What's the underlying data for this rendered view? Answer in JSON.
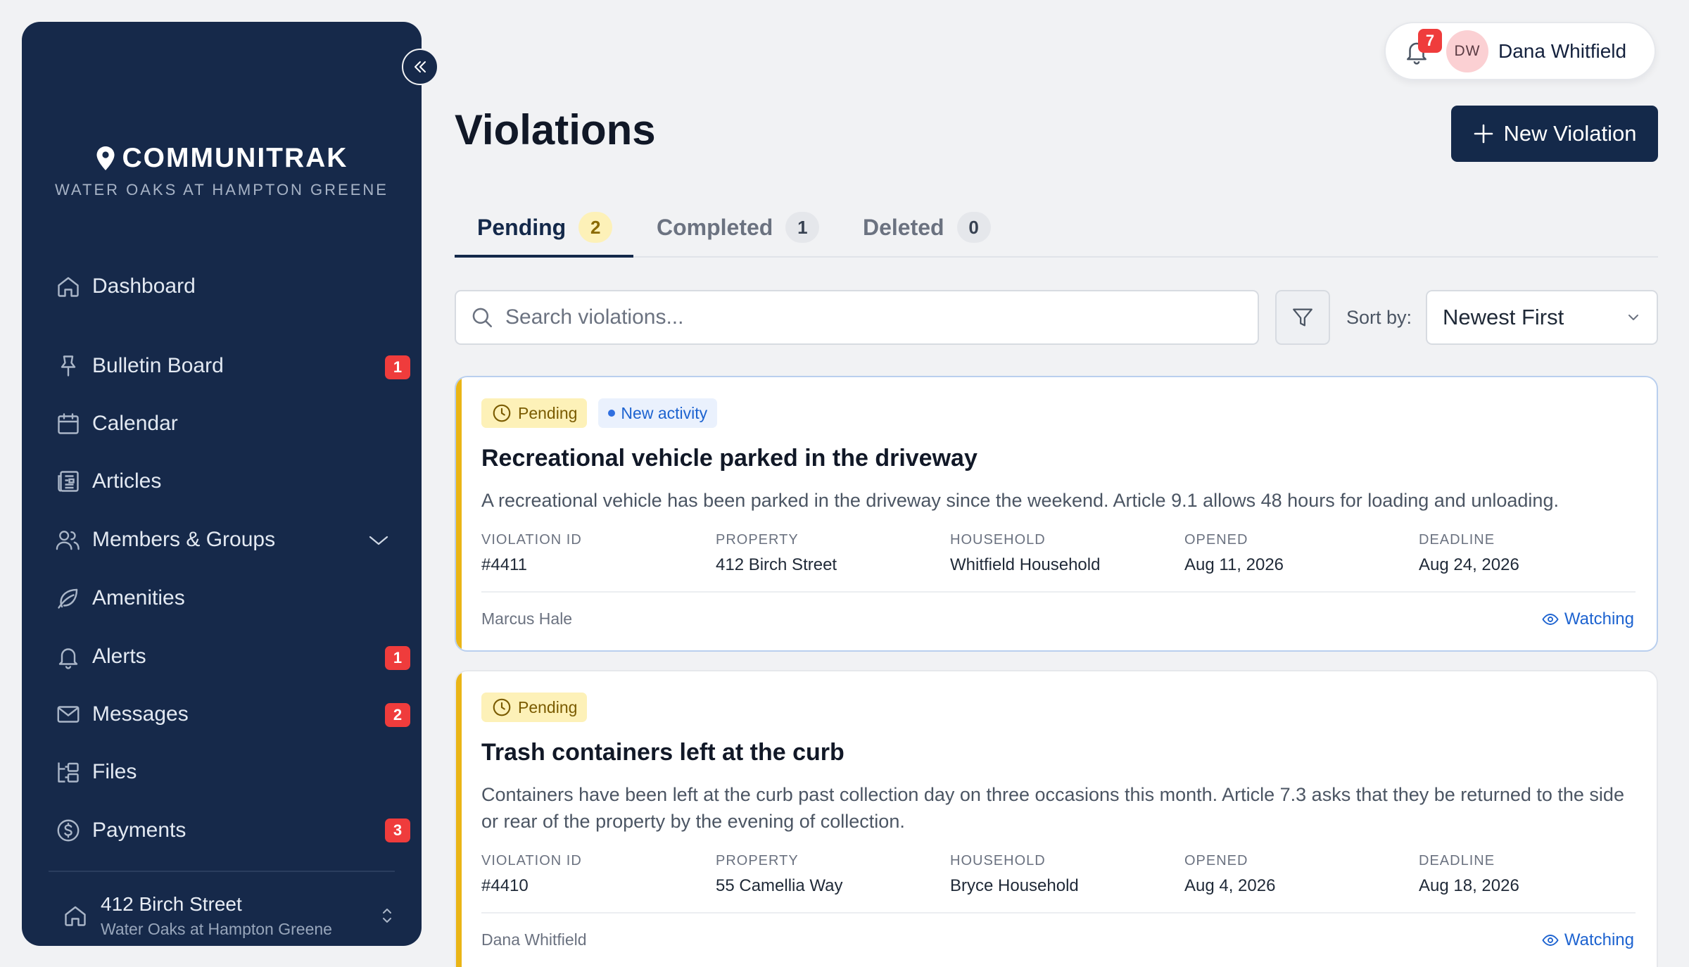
{
  "brand": {
    "name": "COMMUNITRAK",
    "community": "WATER OAKS AT HAMPTON GREENE"
  },
  "sidebar": {
    "items": [
      {
        "label": "Dashboard",
        "icon": "home-icon",
        "badge": ""
      },
      {
        "label": "Bulletin Board",
        "icon": "pin-icon",
        "badge": "1"
      },
      {
        "label": "Calendar",
        "icon": "calendar-icon",
        "badge": ""
      },
      {
        "label": "Articles",
        "icon": "newspaper-icon",
        "badge": ""
      },
      {
        "label": "Members & Groups",
        "icon": "users-icon",
        "badge": ""
      },
      {
        "label": "Amenities",
        "icon": "leaf-icon",
        "badge": ""
      },
      {
        "label": "Alerts",
        "icon": "bell-icon",
        "badge": "1"
      },
      {
        "label": "Messages",
        "icon": "mail-icon",
        "badge": "2"
      },
      {
        "label": "Files",
        "icon": "folder-tree-icon",
        "badge": ""
      },
      {
        "label": "Payments",
        "icon": "dollar-circle-icon",
        "badge": "3"
      }
    ],
    "property": {
      "address": "412 Birch Street",
      "community": "Water Oaks at Hampton Greene"
    }
  },
  "user": {
    "notifications": "7",
    "initials": "DW",
    "name": "Dana Whitfield"
  },
  "header": {
    "title": "Violations",
    "new_button": "New Violation"
  },
  "tabs": [
    {
      "label": "Pending",
      "count": "2"
    },
    {
      "label": "Completed",
      "count": "1"
    },
    {
      "label": "Deleted",
      "count": "0"
    }
  ],
  "toolbar": {
    "search_placeholder": "Search violations...",
    "sort_label": "Sort by:",
    "sort_value": "Newest First"
  },
  "meta_labels": {
    "id": "VIOLATION ID",
    "property": "PROPERTY",
    "household": "HOUSEHOLD",
    "opened": "OPENED",
    "deadline": "DEADLINE"
  },
  "violations": [
    {
      "status": "Pending",
      "activity": "New activity",
      "title": "Recreational vehicle parked in the driveway",
      "description": "A recreational vehicle has been parked in the driveway since the weekend. Article 9.1 allows 48 hours for loading and unloading.",
      "id": "#4411",
      "property": "412 Birch Street",
      "household": "Whitfield Household",
      "opened": "Aug 11, 2026",
      "deadline": "Aug 24, 2026",
      "author": "Marcus Hale",
      "watching": "Watching"
    },
    {
      "status": "Pending",
      "title": "Trash containers left at the curb",
      "description": "Containers have been left at the curb past collection day on three occasions this month. Article 7.3 asks that they be returned to the side or rear of the property by the evening of collection.",
      "id": "#4410",
      "property": "55 Camellia Way",
      "household": "Bryce Household",
      "opened": "Aug 4, 2026",
      "deadline": "Aug 18, 2026",
      "author": "Dana Whitfield",
      "watching": "Watching"
    }
  ],
  "colors": {
    "sidebar": "#16294a",
    "accent_pending": "#eab516",
    "badge": "#ef3c3c",
    "link": "#1d63d0"
  }
}
